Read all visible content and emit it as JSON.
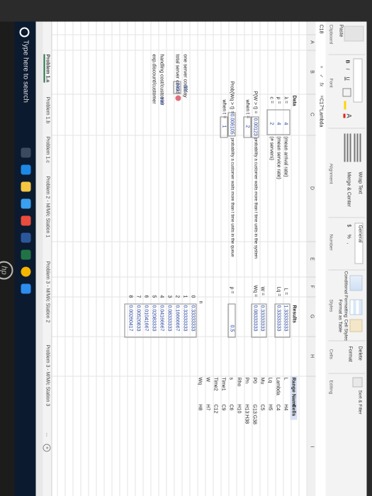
{
  "ribbon": {
    "paste": "Paste",
    "clipboard": "Clipboard",
    "bold": "B",
    "italic": "I",
    "underline": "U",
    "font_group": "Font",
    "wrap_text": "Wrap Text",
    "merge_center": "Merge & Center",
    "alignment_group": "Alignment",
    "number_format": "General",
    "currency": "$",
    "percent": "%",
    "comma": ",",
    "number_group": "Number",
    "conditional_formatting": "Conditional Formatting",
    "format_as_table": "Format as Table",
    "cell_styles": "Cell Styles",
    "styles_group": "Styles",
    "delete": "Delete",
    "format": "Format",
    "cells_group": "Cells",
    "sort_filter": "Sort & Filter",
    "editing_group": "Editing"
  },
  "formula_bar": {
    "name_box": "C18",
    "cancel": "×",
    "enter": "✓",
    "fx": "fx",
    "formula": "=C17*Lambda"
  },
  "columns": [
    "A",
    "B",
    "C",
    "D",
    "E",
    "F",
    "G",
    "H",
    "I"
  ],
  "sheet": {
    "data_title": "Data",
    "lambda_sym": "λ =",
    "lambda_val": "4",
    "lambda_desc": "(mean arrival rate)",
    "mu_sym": "μ =",
    "mu_val": "4",
    "mu_desc": "(mean service rate)",
    "c_sym": "c =",
    "c_val": "2",
    "c_desc": "(# servers)",
    "pwt_label": "P(W > t) =",
    "pwt_val": "0.00123",
    "pwt_desc": "probability a customer waits more than t time units in the system",
    "when_t1": "when t =",
    "t1_val": "2",
    "pwqt_label": "Prob(Wq > t) =",
    "pwqt_val": "0.006105",
    "pwqt_desc": "probability a customer waits more than t time units in the queue",
    "when_t2": "when t =",
    "t2_val": "1",
    "server_cost_label": "one server cost/day",
    "server_cost_val": "50",
    "total_server_label": "total server cost/d",
    "total_server_val": "200",
    "handling_label": "handling cost/customer",
    "handling_val": "100",
    "discount_label": "exp.discount/customer",
    "results_title": "Results",
    "L_label": "L =",
    "L_val": "1.33333333",
    "Lq_label": "Lq =",
    "Lq_val": "0.33333333",
    "W_label": "W =",
    "W_val": "0.33333333",
    "Wq_label": "Wq =",
    "Wq_val": "0.08333333",
    "rho_label": "ρ =",
    "rho_val": "0.5",
    "n_header": "n",
    "pn_list": [
      {
        "n": "0",
        "p": "0.33333333"
      },
      {
        "n": "1",
        "p": "0.33333333"
      },
      {
        "n": "2",
        "p": "0.16666667"
      },
      {
        "n": "3",
        "p": "0.08333333"
      },
      {
        "n": "4",
        "p": "0.04166667"
      },
      {
        "n": "5",
        "p": "0.02083333"
      },
      {
        "n": "6",
        "p": "0.01041667"
      },
      {
        "n": "7",
        "p": "0.00520833"
      },
      {
        "n": "8",
        "p": "0.00260417"
      }
    ],
    "range_name_header": "Range Name",
    "cells_header": "Cells",
    "range_names": [
      {
        "name": "L",
        "cell": "H4"
      },
      {
        "name": "Lambda",
        "cell": "C4"
      },
      {
        "name": "Lq",
        "cell": "H5"
      },
      {
        "name": "Mu",
        "cell": "C5"
      },
      {
        "name": "P0",
        "cell": "G13:G38"
      },
      {
        "name": "Pn",
        "cell": "H13:H38"
      },
      {
        "name": "Rho",
        "cell": "H10"
      },
      {
        "name": "s",
        "cell": "C6"
      },
      {
        "name": "Time1",
        "cell": "C9"
      },
      {
        "name": "Time2",
        "cell": "C12"
      },
      {
        "name": "W",
        "cell": "H7"
      },
      {
        "name": "Wq",
        "cell": "H8"
      }
    ]
  },
  "tabs": {
    "t1": "Problem 1.a",
    "t2": "Problem 1.b",
    "t3": "Problem 1.c",
    "t4": "Problem 2 - M/M/c Station 1",
    "t5": "Problem 3 - M/M/c Station 2",
    "t6": "Problem 3 - M/M/c Station 3",
    "more": "...",
    "add": "+"
  },
  "taskbar": {
    "search_placeholder": "Type here to search"
  },
  "laptop_brand": "hp"
}
